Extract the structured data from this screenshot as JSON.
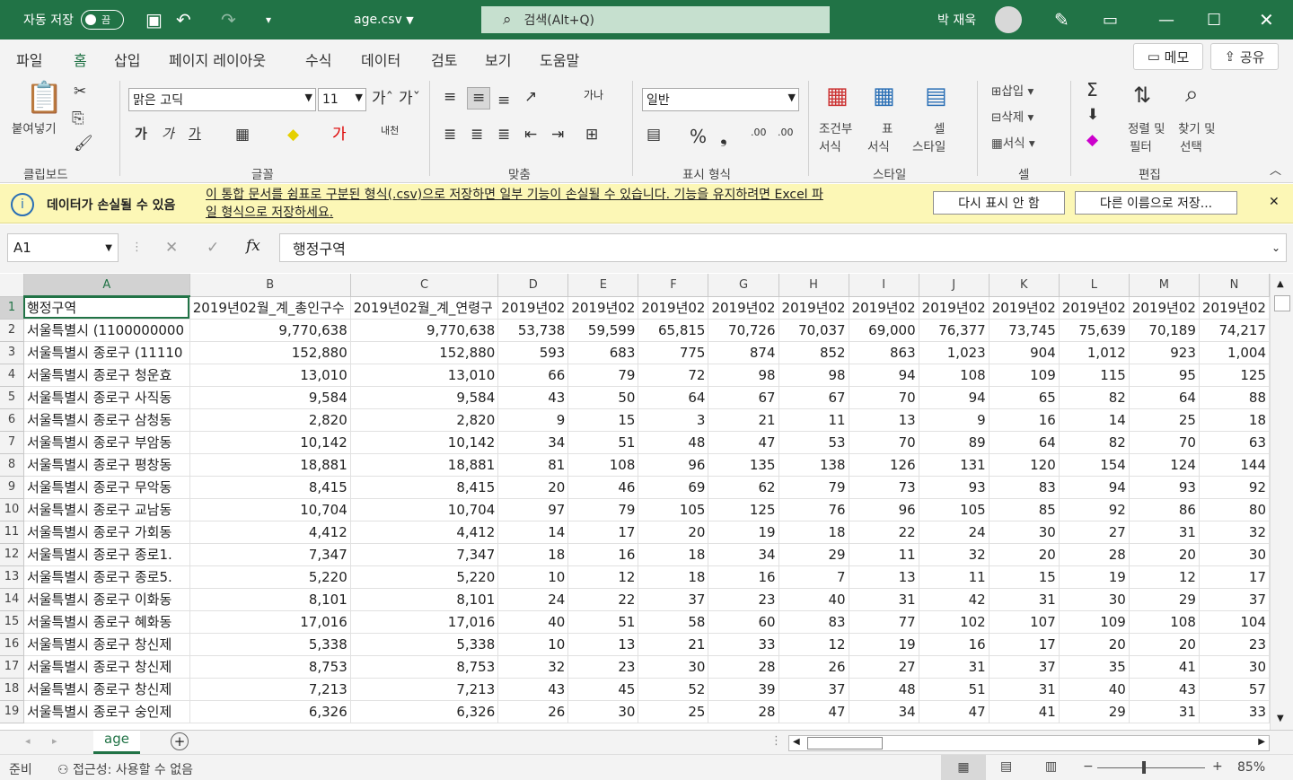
{
  "title": {
    "autosave": "자동 저장",
    "toggle": "끔",
    "filename": "age.csv",
    "search": "검색(Alt+Q)",
    "user": "박 재욱"
  },
  "tabs": [
    "파일",
    "홈",
    "삽입",
    "페이지 레이아웃",
    "수식",
    "데이터",
    "검토",
    "보기",
    "도움말"
  ],
  "buttons": {
    "memo": "메모",
    "share": "공유"
  },
  "ribbon": {
    "paste": "붙여넣기",
    "clipboard": "클립보드",
    "font_name": "맑은 고딕",
    "font_size": "11",
    "font": "글꼴",
    "align": "맞춤",
    "number_format": "일반",
    "number": "표시 형식",
    "cond1": "조건부",
    "cond2": "서식",
    "table1": "표",
    "table2": "서식",
    "cell1": "셀",
    "cell2": "스타일",
    "style": "스타일",
    "insert": "삽입",
    "delete": "삭제",
    "format": "서식",
    "cells": "셀",
    "sort1": "정렬 및",
    "sort2": "필터",
    "find1": "찾기 및",
    "find2": "선택",
    "editing": "편집",
    "bold": "가",
    "italic": "가",
    "underline": "가",
    "wrap": "가나"
  },
  "message": {
    "title": "데이터가 손실될 수 있음",
    "text1": "이 통합 문서를 쉼표로 구분된 형식(.csv)으로 저장하면 일부 기능이 손실될 수 있습니다. 기능을 유지하려면 Excel 파",
    "text2": "일 형식으로 저장하세요.",
    "btn1": "다시 표시 안 함",
    "btn2": "다른 이름으로 저장..."
  },
  "namebox": "A1",
  "formula": "행정구역",
  "columns": [
    "A",
    "B",
    "C",
    "D",
    "E",
    "F",
    "G",
    "H",
    "I",
    "J",
    "K",
    "L",
    "M",
    "N"
  ],
  "rows": [
    [
      "행정구역",
      "2019년02월_계_총인구수",
      "2019년02월_계_연령구",
      "2019년02",
      "2019년02",
      "2019년02",
      "2019년02",
      "2019년02",
      "2019년02",
      "2019년02",
      "2019년02",
      "2019년02",
      "2019년02",
      "2019년02"
    ],
    [
      "서울특별시  (1100000000",
      "9,770,638",
      "9,770,638",
      "53,738",
      "59,599",
      "65,815",
      "70,726",
      "70,037",
      "69,000",
      "76,377",
      "73,745",
      "75,639",
      "70,189",
      "74,217"
    ],
    [
      "서울특별시 종로구 (11110",
      "152,880",
      "152,880",
      "593",
      "683",
      "775",
      "874",
      "852",
      "863",
      "1,023",
      "904",
      "1,012",
      "923",
      "1,004"
    ],
    [
      "서울특별시 종로구 청운효",
      "13,010",
      "13,010",
      "66",
      "79",
      "72",
      "98",
      "98",
      "94",
      "108",
      "109",
      "115",
      "95",
      "125"
    ],
    [
      "서울특별시 종로구 사직동",
      "9,584",
      "9,584",
      "43",
      "50",
      "64",
      "67",
      "67",
      "70",
      "94",
      "65",
      "82",
      "64",
      "88"
    ],
    [
      "서울특별시 종로구 삼청동",
      "2,820",
      "2,820",
      "9",
      "15",
      "3",
      "21",
      "11",
      "13",
      "9",
      "16",
      "14",
      "25",
      "18"
    ],
    [
      "서울특별시 종로구 부암동",
      "10,142",
      "10,142",
      "34",
      "51",
      "48",
      "47",
      "53",
      "70",
      "89",
      "64",
      "82",
      "70",
      "63"
    ],
    [
      "서울특별시 종로구 평창동",
      "18,881",
      "18,881",
      "81",
      "108",
      "96",
      "135",
      "138",
      "126",
      "131",
      "120",
      "154",
      "124",
      "144"
    ],
    [
      "서울특별시 종로구 무악동",
      "8,415",
      "8,415",
      "20",
      "46",
      "69",
      "62",
      "79",
      "73",
      "93",
      "83",
      "94",
      "93",
      "92"
    ],
    [
      "서울특별시 종로구 교남동",
      "10,704",
      "10,704",
      "97",
      "79",
      "105",
      "125",
      "76",
      "96",
      "105",
      "85",
      "92",
      "86",
      "80"
    ],
    [
      "서울특별시 종로구 가회동",
      "4,412",
      "4,412",
      "14",
      "17",
      "20",
      "19",
      "18",
      "22",
      "24",
      "30",
      "27",
      "31",
      "32"
    ],
    [
      "서울특별시 종로구 종로1.",
      "7,347",
      "7,347",
      "18",
      "16",
      "18",
      "34",
      "29",
      "11",
      "32",
      "20",
      "28",
      "20",
      "30"
    ],
    [
      "서울특별시 종로구 종로5.",
      "5,220",
      "5,220",
      "10",
      "12",
      "18",
      "16",
      "7",
      "13",
      "11",
      "15",
      "19",
      "12",
      "17"
    ],
    [
      "서울특별시 종로구 이화동",
      "8,101",
      "8,101",
      "24",
      "22",
      "37",
      "23",
      "40",
      "31",
      "42",
      "31",
      "30",
      "29",
      "37"
    ],
    [
      "서울특별시 종로구 혜화동",
      "17,016",
      "17,016",
      "40",
      "51",
      "58",
      "60",
      "83",
      "77",
      "102",
      "107",
      "109",
      "108",
      "104"
    ],
    [
      "서울특별시 종로구 창신제",
      "5,338",
      "5,338",
      "10",
      "13",
      "21",
      "33",
      "12",
      "19",
      "16",
      "17",
      "20",
      "20",
      "23"
    ],
    [
      "서울특별시 종로구 창신제",
      "8,753",
      "8,753",
      "32",
      "23",
      "30",
      "28",
      "26",
      "27",
      "31",
      "37",
      "35",
      "41",
      "30"
    ],
    [
      "서울특별시 종로구 창신제",
      "7,213",
      "7,213",
      "43",
      "45",
      "52",
      "39",
      "37",
      "48",
      "51",
      "31",
      "40",
      "43",
      "57"
    ],
    [
      "서울특별시 종로구 숭인제",
      "6,326",
      "6,326",
      "26",
      "30",
      "25",
      "28",
      "47",
      "34",
      "47",
      "41",
      "29",
      "31",
      "33"
    ]
  ],
  "sheet": "age",
  "status": {
    "ready": "준비",
    "accessibility": "접근성: 사용할 수 없음",
    "zoom": "85%"
  }
}
